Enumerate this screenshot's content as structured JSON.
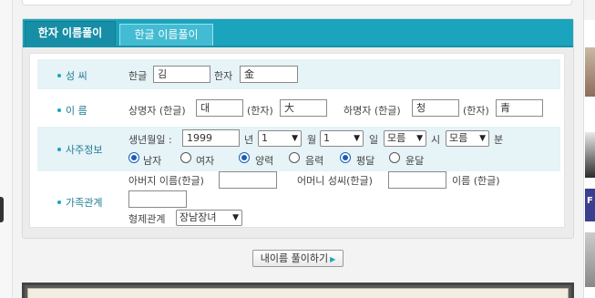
{
  "tabs": [
    {
      "label": "한자 이름풀이",
      "active": true
    },
    {
      "label": "한글 이름풀이",
      "active": false
    }
  ],
  "surname": {
    "label": "성 씨",
    "hangul_label": "한글",
    "hangul_value": "김",
    "hanja_label": "한자",
    "hanja_value": "金"
  },
  "given_name": {
    "label": "이 름",
    "upper_label": "상명자 (한글)",
    "upper_hangul": "대",
    "upper_hanja_label": "(한자)",
    "upper_hanja": "大",
    "lower_label": "하명자 (한글)",
    "lower_hangul": "청",
    "lower_hanja_label": "(한자)",
    "lower_hanja": "青"
  },
  "saju": {
    "label": "사주정보",
    "birth_label": "생년월일 :",
    "year_value": "1999",
    "year_unit": "년",
    "month_value": "1",
    "month_unit": "월",
    "day_value": "1",
    "day_unit": "일",
    "hour_value": "모름",
    "hour_unit": "시",
    "minute_value": "모름",
    "minute_unit": "분",
    "gender_options": [
      "남자",
      "여자"
    ],
    "gender_selected": "남자",
    "calendar_options": [
      "양력",
      "음력"
    ],
    "calendar_selected": "양력",
    "leap_options": [
      "평달",
      "윤달"
    ],
    "leap_selected": "평달"
  },
  "family": {
    "label": "가족관계",
    "father_label": "아버지 이름(한글)",
    "father_value": "",
    "mother_surname_label": "어머니 성씨(한글)",
    "mother_surname_value": "",
    "mother_name_label": "이름 (한글)",
    "mother_name_value": "",
    "sibling_label": "형제관계",
    "sibling_value": "장남장녀"
  },
  "submit_label": "내이름 풀이하기",
  "colors": {
    "accent": "#1aa4bd",
    "tab_active": "#178ea6",
    "row_shade": "#e6f3f7",
    "label_text": "#1e7d96",
    "radio_on": "#1a5fb4"
  },
  "icons": {
    "select_caret": "chevron-down-icon",
    "submit_arrow": "triangle-right-icon"
  }
}
